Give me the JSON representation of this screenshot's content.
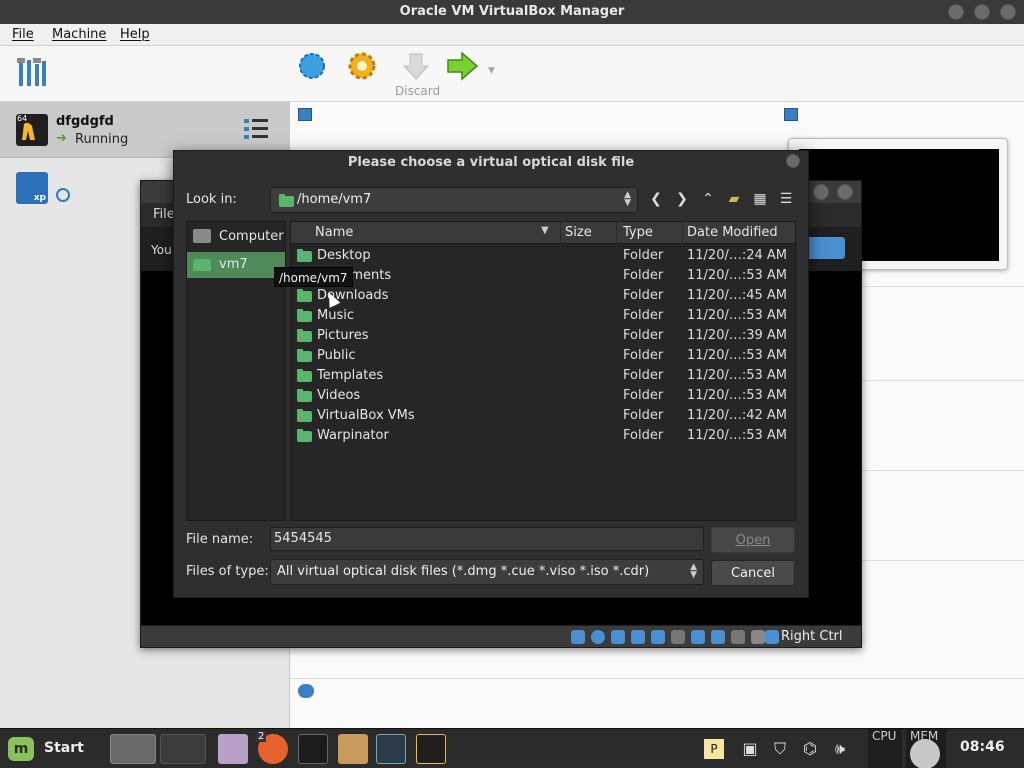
{
  "window": {
    "title": "Oracle VM VirtualBox Manager"
  },
  "menu": {
    "file": "File",
    "machine": "Machine",
    "help": "Help"
  },
  "toolbar": {
    "discard_label": "Discard"
  },
  "vms": [
    {
      "name": "dfgdgfd",
      "state": "Running",
      "badge": "64"
    },
    {
      "name": "",
      "state": "",
      "badge": "xp"
    }
  ],
  "vm_window": {
    "menu_file_partial": "File",
    "screen_text_partial": "You",
    "status_host_key": "Right Ctrl"
  },
  "dialog": {
    "title": "Please choose a virtual optical disk file",
    "look_in_label": "Look in:",
    "look_in_value": "/home/vm7",
    "places": [
      {
        "label": "Computer"
      },
      {
        "label": "vm7"
      }
    ],
    "columns": {
      "name": "Name",
      "size": "Size",
      "type": "Type",
      "date": "Date Modified"
    },
    "files": [
      {
        "name": "Desktop",
        "type": "Folder",
        "date": "11/20/…:24 AM"
      },
      {
        "name": "Documents",
        "type": "Folder",
        "date": "11/20/…:53 AM"
      },
      {
        "name": "Downloads",
        "type": "Folder",
        "date": "11/20/…:45 AM"
      },
      {
        "name": "Music",
        "type": "Folder",
        "date": "11/20/…:53 AM"
      },
      {
        "name": "Pictures",
        "type": "Folder",
        "date": "11/20/…:39 AM"
      },
      {
        "name": "Public",
        "type": "Folder",
        "date": "11/20/…:53 AM"
      },
      {
        "name": "Templates",
        "type": "Folder",
        "date": "11/20/…:53 AM"
      },
      {
        "name": "Videos",
        "type": "Folder",
        "date": "11/20/…:53 AM"
      },
      {
        "name": "VirtualBox VMs",
        "type": "Folder",
        "date": "11/20/…:42 AM"
      },
      {
        "name": "Warpinator",
        "type": "Folder",
        "date": "11/20/…:53 AM"
      }
    ],
    "file_name_label": "File name:",
    "file_name_value": "5454545",
    "files_of_type_label": "Files of type:",
    "files_of_type_value": "All virtual optical disk files (*.dmg *.cue *.viso *.iso *.cdr)",
    "open_button": "Open",
    "cancel_button": "Cancel",
    "tooltip": "/home/vm7"
  },
  "taskbar": {
    "start_label": "Start",
    "firefox_badge": "2",
    "cpu_label": "CPU",
    "mem_label": "MEM",
    "clock": "08:46"
  },
  "colors": {
    "accent_green": "#5ab56e",
    "dialog_bg": "#2f2f2f",
    "selection": "#4f8a5b"
  }
}
